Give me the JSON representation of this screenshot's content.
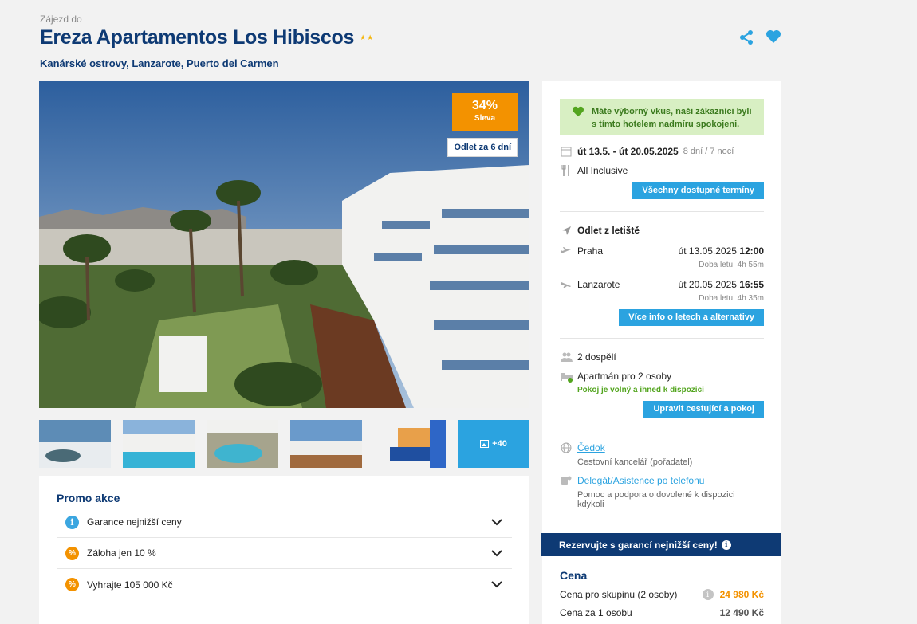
{
  "header": {
    "pre_title": "Zájezd do",
    "title": "Ereza Apartamentos Los Hibiscos",
    "stars": "★★",
    "location": "Kanárské ostrovy, Lanzarote, Puerto del Carmen",
    "icons": [
      "share-icon",
      "heart-icon"
    ]
  },
  "gallery": {
    "discount_pct": "34%",
    "discount_label": "Sleva",
    "departure_badge": "Odlet za 6 dní",
    "more_label": "+40"
  },
  "promo": {
    "title": "Promo akce",
    "items": [
      {
        "label": "Garance nejnižší ceny",
        "icon": "info-icon"
      },
      {
        "label": "Záloha jen 10 %",
        "icon": "percent-icon"
      },
      {
        "label": "Vyhrajte 105 000 Kč",
        "icon": "percent-icon"
      }
    ]
  },
  "side": {
    "notice": "Máte výborný vkus, naši zákazníci byli s tímto hotelem nadmíru spokojeni.",
    "dates": "út 13.5. - út 20.05.2025",
    "nights": "8 dní / 7 nocí",
    "board": "All Inclusive",
    "terms_button": "Všechny dostupné termíny",
    "flight_heading": "Odlet z letiště",
    "flights": [
      {
        "place": "Praha",
        "date": "út 13.05.2025",
        "time": "12:00",
        "duration": "Doba letu: 4h 55m"
      },
      {
        "place": "Lanzarote",
        "date": "út 20.05.2025",
        "time": "16:55",
        "duration": "Doba letu: 4h 35m"
      }
    ],
    "flight_button": "Více info o letech a alternativy",
    "travellers": "2 dospělí",
    "room": "Apartmán pro 2 osoby",
    "availability": "Pokoj je volný a ihned k dispozici",
    "room_button": "Upravit cestující a pokoj",
    "agency_link": "Čedok",
    "agency_sub": "Cestovní kancelář (pořadatel)",
    "delegate_link": "Delegát/Asistence po telefonu",
    "delegate_sub": "Pomoc a podpora o dovolené k dispozici kdykoli",
    "guarantee": "Rezervujte s garancí nejnižší ceny!",
    "price_title": "Cena",
    "price_group_label": "Cena pro skupinu (2 osoby)",
    "price_group": "24 980 Kč",
    "price_person_label": "Cena za 1 osobu",
    "price_person": "12 490 Kč"
  },
  "colors": {
    "brand": "#0e3a74",
    "accent": "#2ba3e0",
    "discount": "#f39200",
    "success": "#53a51f"
  }
}
